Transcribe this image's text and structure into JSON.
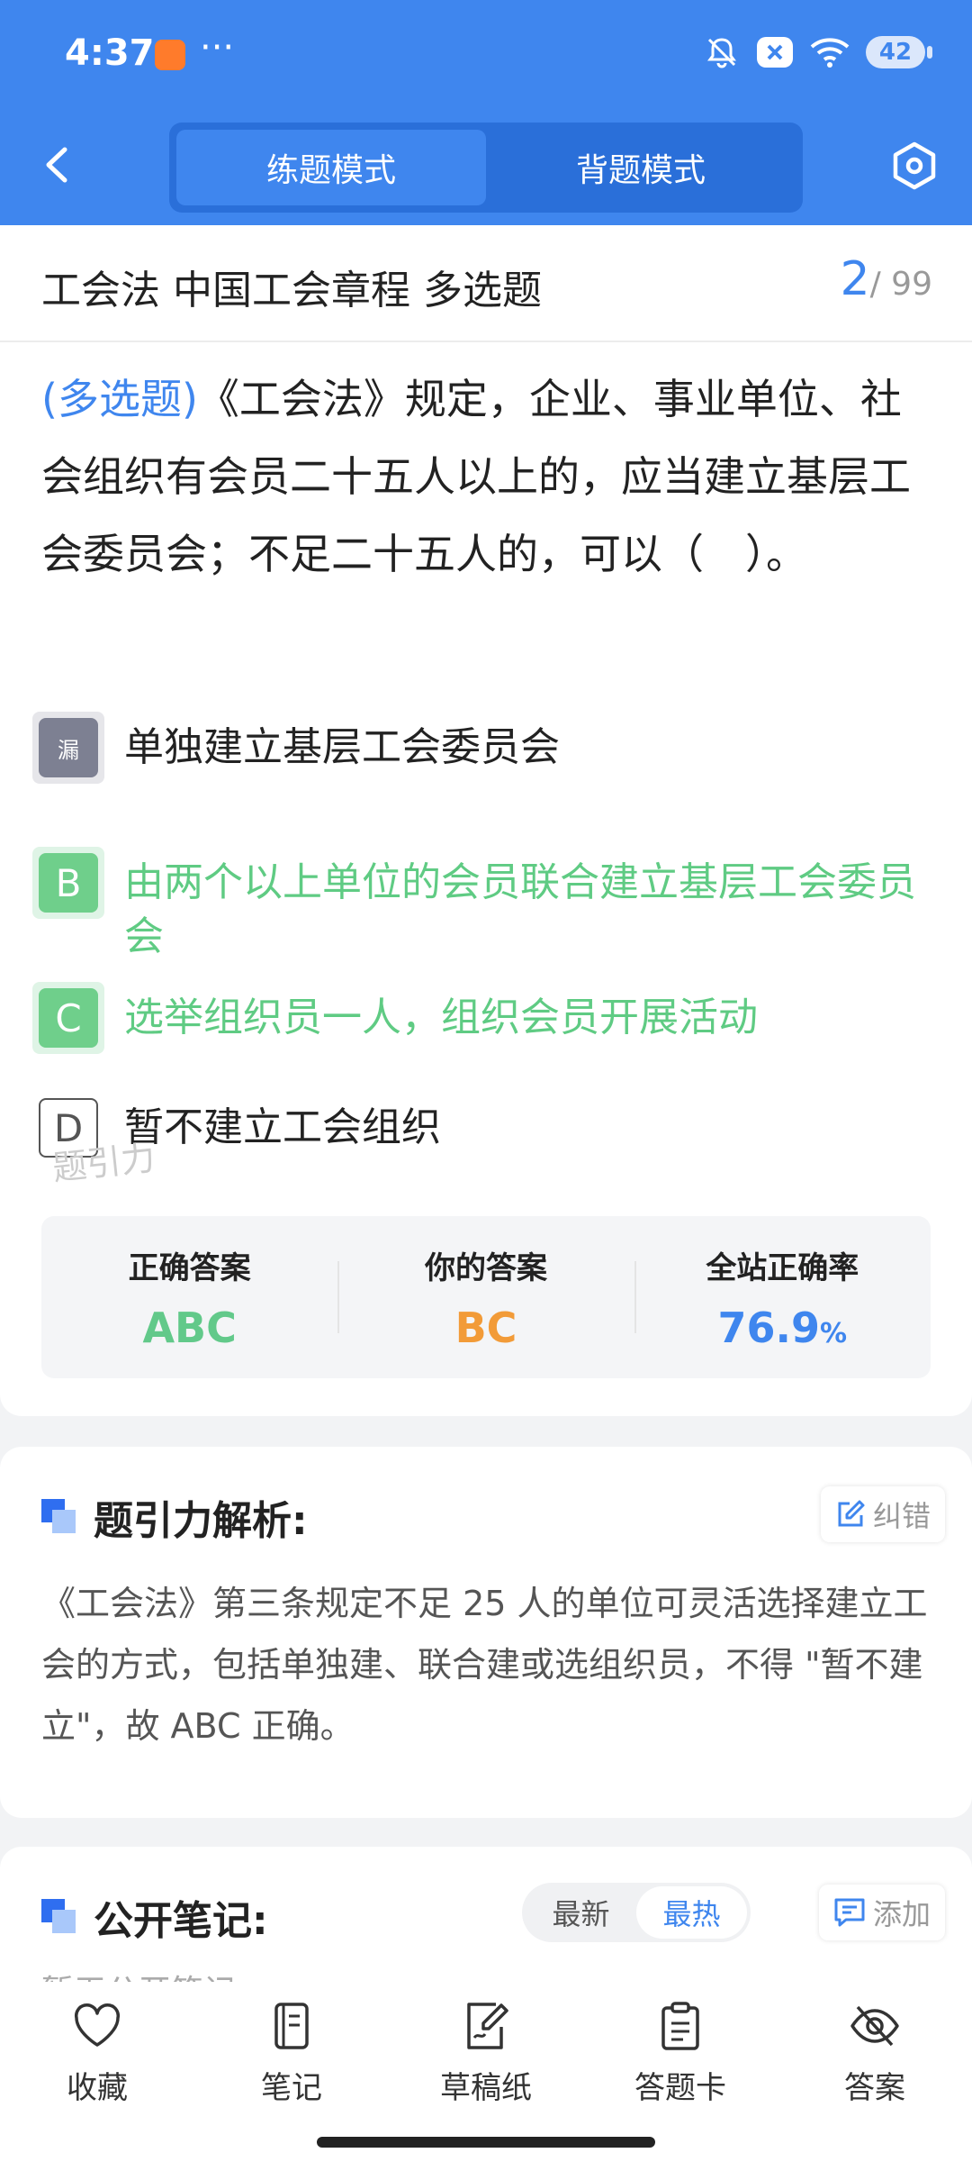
{
  "status_bar": {
    "time": "4:37",
    "more": "···",
    "battery": "42"
  },
  "header": {
    "tabs": [
      {
        "label": "练题模式",
        "active": true
      },
      {
        "label": "背题模式",
        "active": false
      }
    ]
  },
  "subject": {
    "title": "工会法 中国工会章程 多选题",
    "current": "2",
    "total": "/ 99"
  },
  "question": {
    "type": "(多选题)",
    "text": "《工会法》规定，企业、事业单位、社会组织有会员二十五人以上的，应当建立基层工会委员会；不足二十五人的，可以（　）。"
  },
  "options": [
    {
      "badge": "漏",
      "text": "单独建立基层工会委员会",
      "state": "missed"
    },
    {
      "badge": "B",
      "text": "由两个以上单位的会员联合建立基层工会委员会",
      "state": "correct"
    },
    {
      "badge": "C",
      "text": "选举组织员一人，组织会员开展活动",
      "state": "correct"
    },
    {
      "badge": "D",
      "text": "暂不建立工会组织",
      "state": "normal"
    }
  ],
  "watermark": "题引力",
  "stats": {
    "correct_label": "正确答案",
    "correct_value": "ABC",
    "yours_label": "你的答案",
    "yours_value": "BC",
    "rate_label": "全站正确率",
    "rate_value": "76.9",
    "rate_unit": "%"
  },
  "analysis": {
    "title": "题引力解析:",
    "report_label": "纠错",
    "text": "《工会法》第三条规定不足 25 人的单位可灵活选择建立工会的方式，包括单独建、联合建或选组织员，不得 \"暂不建立\"，故 ABC 正确。"
  },
  "notes": {
    "title": "公开笔记:",
    "sort_new": "最新",
    "sort_hot": "最热",
    "add_label": "添加",
    "empty_text": "暂无公开笔记"
  },
  "bottom_nav": [
    {
      "label": "收藏",
      "icon": "heart-icon"
    },
    {
      "label": "笔记",
      "icon": "notebook-icon"
    },
    {
      "label": "草稿纸",
      "icon": "draft-icon"
    },
    {
      "label": "答题卡",
      "icon": "clipboard-icon"
    },
    {
      "label": "答案",
      "icon": "eye-off-icon"
    }
  ],
  "colors": {
    "primary": "#3f86ee",
    "correct": "#62c98a",
    "yours": "#f29b38",
    "missed": "#7d8092"
  }
}
